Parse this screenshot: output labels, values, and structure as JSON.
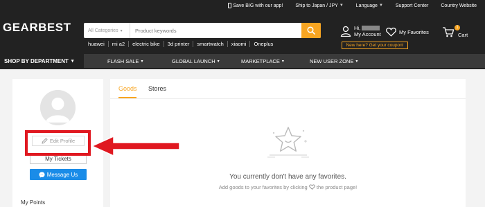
{
  "utility_bar": {
    "app_label": "Save BIG with our app!",
    "ship_to": "Ship to Japan / JPY",
    "language": "Language",
    "support": "Support Center",
    "country": "Country Website"
  },
  "logo": {
    "text": "GEARBEST"
  },
  "search": {
    "category": "All Categories",
    "placeholder": "Product keywords",
    "hot_words": [
      "huawei",
      "mi a2",
      "electric bike",
      "3d printer",
      "smartwatch",
      "xiaomi",
      "Oneplus"
    ]
  },
  "header_actions": {
    "greeting": "Hi,",
    "account": "My Account",
    "favorites": "My Favorites",
    "cart": "Cart",
    "cart_count": "1",
    "coupon": "New here? Get your coupon!"
  },
  "nav": {
    "department": "SHOP BY DEPARTMENT",
    "links": [
      "FLASH SALE",
      "GLOBAL LAUNCH",
      "MARKETPLACE",
      "NEW USER ZONE"
    ]
  },
  "profile": {
    "edit_label": "Edit Profile",
    "tickets_label": "My Tickets",
    "message_label": "Message Us",
    "points_label": "My Points"
  },
  "favorites_panel": {
    "tabs": [
      "Goods",
      "Stores"
    ],
    "active_tab": "Goods",
    "empty_title": "You currently don't have any favorites.",
    "empty_sub_before": "Add goods to your favorites by clicking",
    "empty_sub_after": "the product page!"
  },
  "colors": {
    "accent": "#f8a521",
    "header_bg": "#222222",
    "messenger_blue": "#1a8ce8",
    "highlight_red": "#e01820"
  },
  "icons": [
    "phone-icon",
    "search-icon",
    "user-icon",
    "heart-icon",
    "cart-icon",
    "pencil-icon",
    "messenger-icon",
    "star-icon",
    "arrow-annotation"
  ]
}
